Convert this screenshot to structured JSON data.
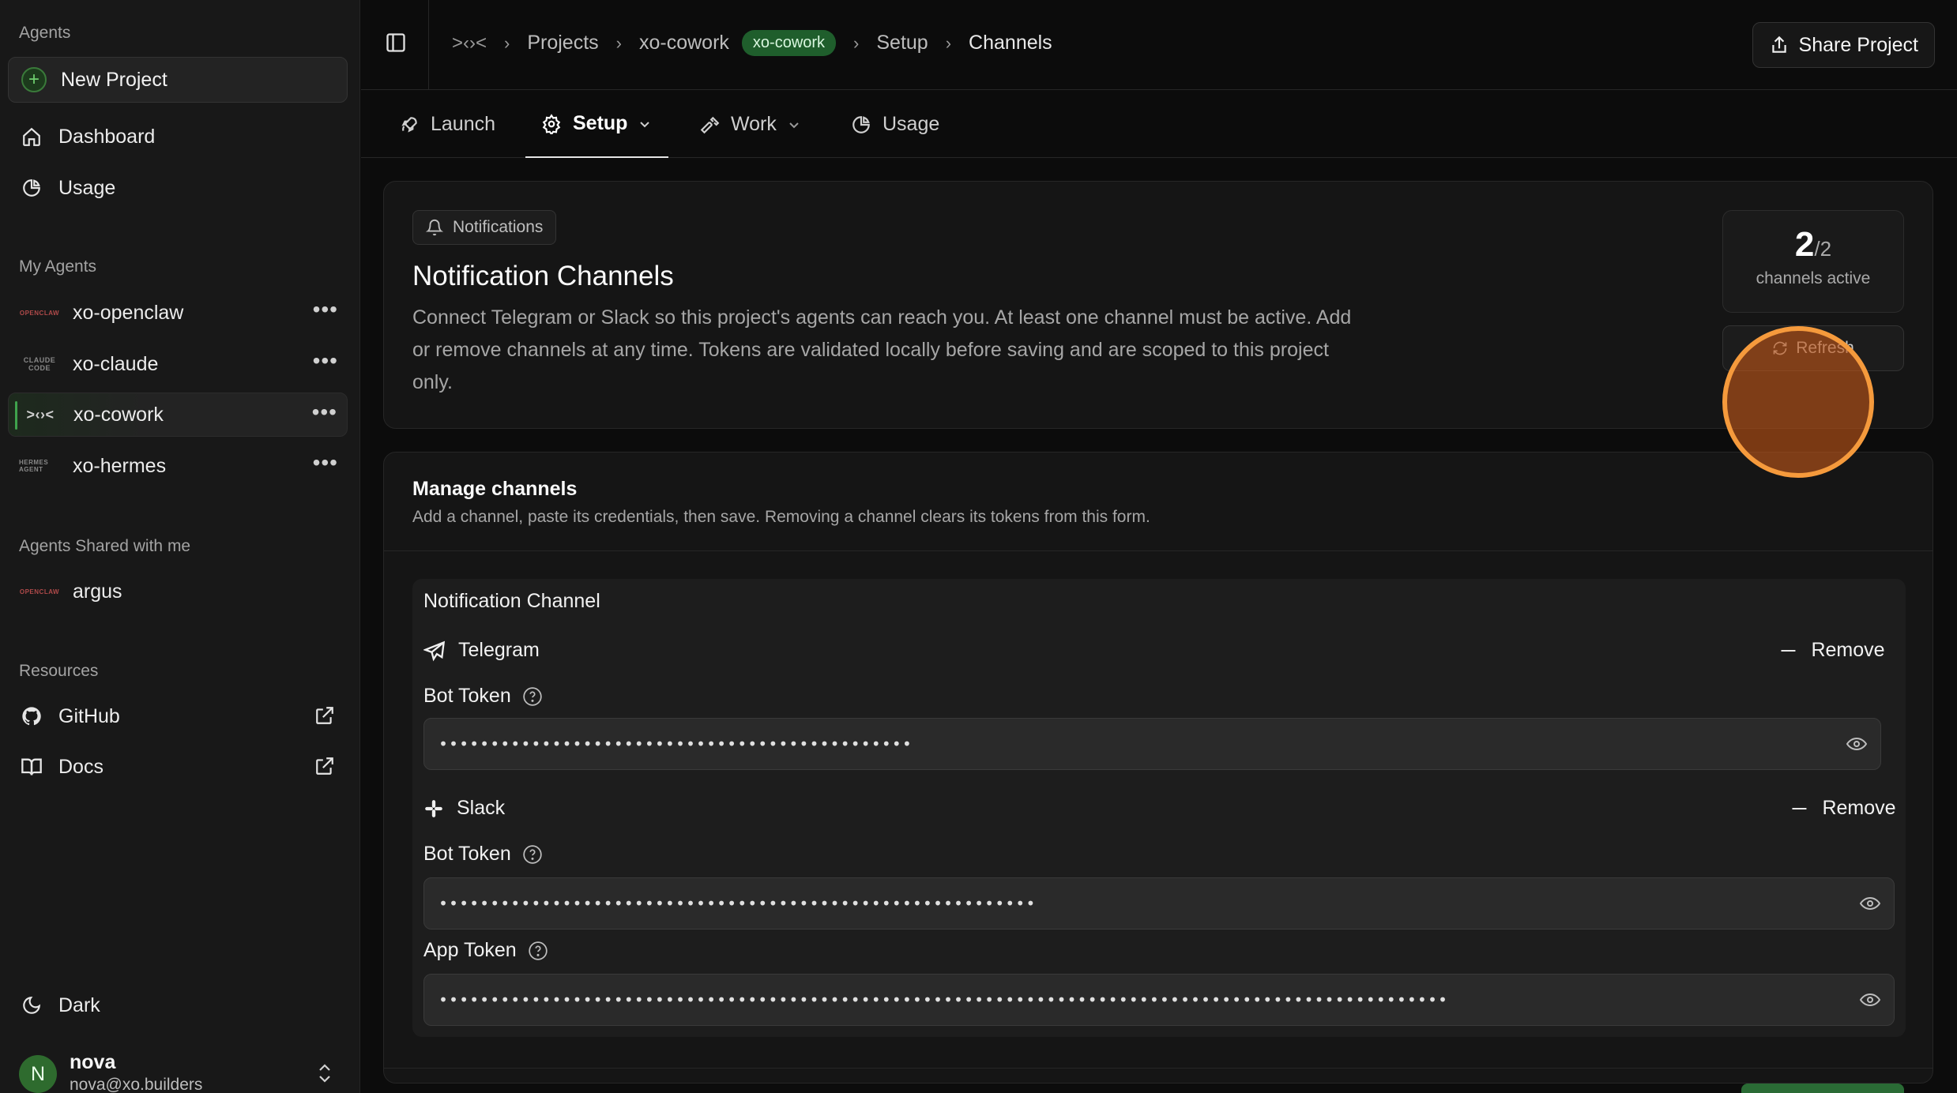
{
  "sidebar": {
    "agents_heading": "Agents",
    "new_project_label": "New Project",
    "nav": [
      {
        "label": "Dashboard",
        "icon": "home-icon"
      },
      {
        "label": "Usage",
        "icon": "pie-chart-icon"
      }
    ],
    "my_agents_heading": "My Agents",
    "my_agents": [
      {
        "label": "xo-openclaw",
        "logo": "OPENCLAW"
      },
      {
        "label": "xo-claude",
        "logo": "CLAUDE CODE"
      },
      {
        "label": "xo-cowork",
        "logo": ">‹›<"
      },
      {
        "label": "xo-hermes",
        "logo": "HERMES AGENT"
      }
    ],
    "shared_heading": "Agents Shared with me",
    "shared_agents": [
      {
        "label": "argus",
        "logo": "OPENCLAW"
      }
    ],
    "resources_heading": "Resources",
    "resources": [
      {
        "label": "GitHub",
        "icon": "github-icon"
      },
      {
        "label": "Docs",
        "icon": "book-icon"
      }
    ],
    "theme_label": "Dark",
    "user": {
      "initial": "N",
      "name": "nova",
      "email": "nova@xo.builders"
    }
  },
  "topbar": {
    "breadcrumbs": [
      "Projects",
      "xo-cowork",
      "Setup",
      "Channels"
    ],
    "project_badge": "xo-cowork",
    "share_label": "Share Project"
  },
  "tabs": [
    {
      "label": "Launch",
      "icon": "rocket-icon"
    },
    {
      "label": "Setup",
      "icon": "gear-icon",
      "active": true
    },
    {
      "label": "Work",
      "icon": "hammer-icon"
    },
    {
      "label": "Usage",
      "icon": "pie-chart-icon"
    }
  ],
  "notifications": {
    "chip_label": "Notifications",
    "title": "Notification Channels",
    "description": "Connect Telegram or Slack so this project's agents can reach you. At least one channel must be active. Add or remove channels at any time. Tokens are validated locally before saving and are scoped to this project only.",
    "active_count": "2",
    "active_total": "/2",
    "active_label": "channels active",
    "refresh_label": "Refresh"
  },
  "manage": {
    "title": "Manage channels",
    "description": "Add a channel, paste its credentials, then save. Removing a channel clears its tokens from this form.",
    "section_title": "Notification Channel",
    "remove_label": "Remove",
    "telegram": {
      "name": "Telegram",
      "bot_token_label": "Bot Token",
      "bot_token_value": "••••••••••••••••••••••••••••••••••••••••••••••"
    },
    "slack": {
      "name": "Slack",
      "bot_token_label": "Bot Token",
      "bot_token_value": "••••••••••••••••••••••••••••••••••••••••••••••••••••••••••",
      "app_token_label": "App Token",
      "app_token_value": "••••••••••••••••••••••••••••••••••••••••••••••••••••••••••••••••••••••••••••••••••••••••••••••••••"
    }
  },
  "colors": {
    "accent_green": "#1f5e2c",
    "cursor_ring": "#f59a3c"
  }
}
